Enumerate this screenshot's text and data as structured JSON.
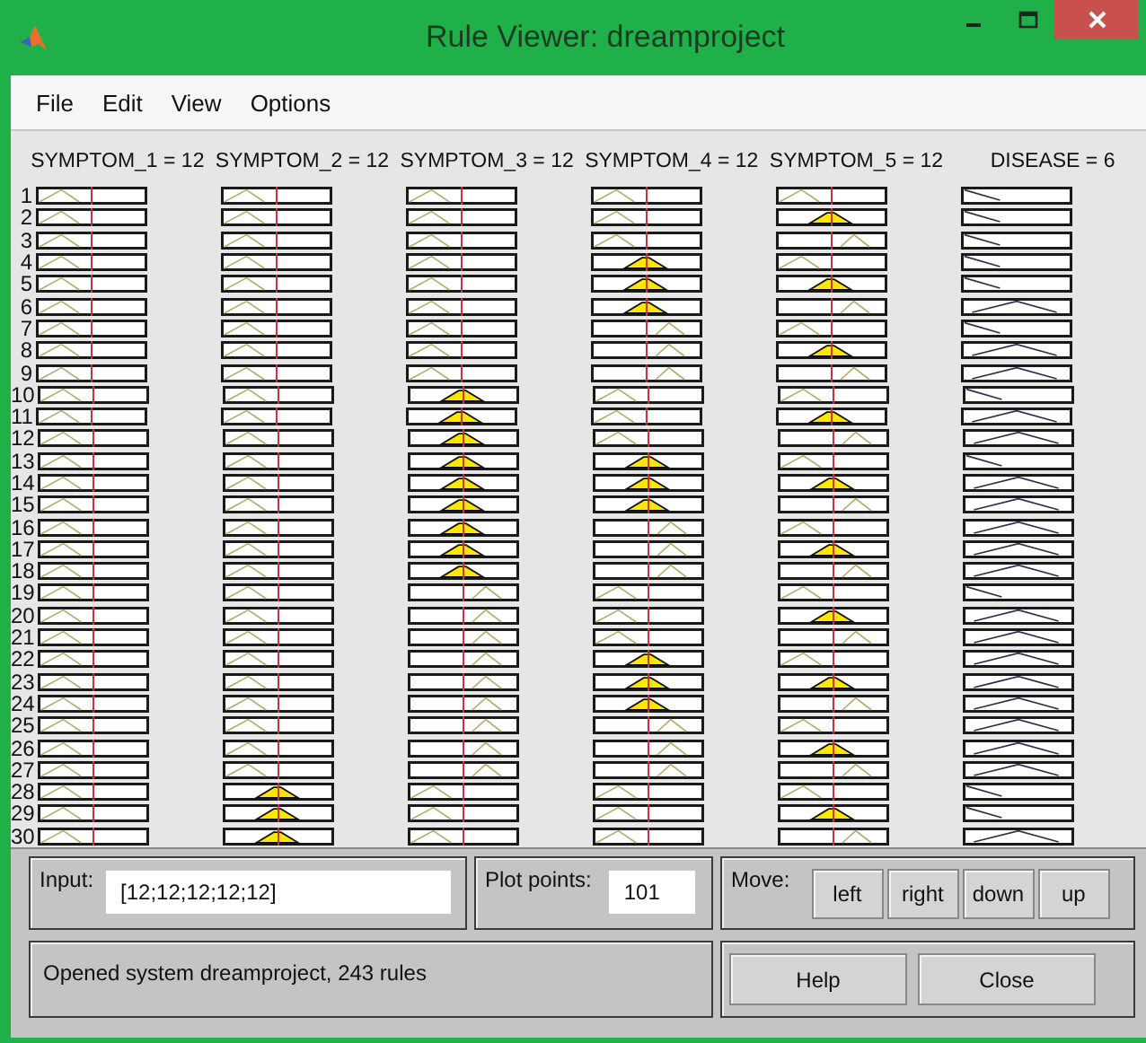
{
  "window": {
    "title": "Rule Viewer: dreamproject"
  },
  "menu": [
    "File",
    "Edit",
    "View",
    "Options"
  ],
  "variables": [
    {
      "label": "SYMPTOM_1 = 12",
      "kind": "input"
    },
    {
      "label": "SYMPTOM_2 = 12",
      "kind": "input"
    },
    {
      "label": "SYMPTOM_3 = 12",
      "kind": "input"
    },
    {
      "label": "SYMPTOM_4 = 12",
      "kind": "input"
    },
    {
      "label": "SYMPTOM_5 = 12",
      "kind": "input"
    },
    {
      "label": "DISEASE = 6",
      "kind": "output"
    }
  ],
  "rules": [
    {
      "number": "1",
      "inputs": [
        {
          "kind": "low",
          "fired": false
        },
        {
          "kind": "low",
          "fired": false
        },
        {
          "kind": "low",
          "fired": false
        },
        {
          "kind": "low",
          "fired": false
        },
        {
          "kind": "low",
          "fired": false
        }
      ],
      "output": {
        "kind": "low"
      }
    },
    {
      "number": "2",
      "inputs": [
        {
          "kind": "low",
          "fired": false
        },
        {
          "kind": "low",
          "fired": false
        },
        {
          "kind": "low",
          "fired": false
        },
        {
          "kind": "low",
          "fired": false
        },
        {
          "kind": "mid",
          "fired": true
        }
      ],
      "output": {
        "kind": "low"
      }
    },
    {
      "number": "3",
      "inputs": [
        {
          "kind": "low",
          "fired": false
        },
        {
          "kind": "low",
          "fired": false
        },
        {
          "kind": "low",
          "fired": false
        },
        {
          "kind": "low",
          "fired": false
        },
        {
          "kind": "high",
          "fired": false
        }
      ],
      "output": {
        "kind": "low"
      }
    },
    {
      "number": "4",
      "inputs": [
        {
          "kind": "low",
          "fired": false
        },
        {
          "kind": "low",
          "fired": false
        },
        {
          "kind": "low",
          "fired": false
        },
        {
          "kind": "mid",
          "fired": true
        },
        {
          "kind": "low",
          "fired": false
        }
      ],
      "output": {
        "kind": "low"
      }
    },
    {
      "number": "5",
      "inputs": [
        {
          "kind": "low",
          "fired": false
        },
        {
          "kind": "low",
          "fired": false
        },
        {
          "kind": "low",
          "fired": false
        },
        {
          "kind": "mid",
          "fired": true
        },
        {
          "kind": "mid",
          "fired": true
        }
      ],
      "output": {
        "kind": "low"
      }
    },
    {
      "number": "6",
      "inputs": [
        {
          "kind": "low",
          "fired": false
        },
        {
          "kind": "low",
          "fired": false
        },
        {
          "kind": "low",
          "fired": false
        },
        {
          "kind": "mid",
          "fired": true
        },
        {
          "kind": "high",
          "fired": false
        }
      ],
      "output": {
        "kind": "mid"
      }
    },
    {
      "number": "7",
      "inputs": [
        {
          "kind": "low",
          "fired": false
        },
        {
          "kind": "low",
          "fired": false
        },
        {
          "kind": "low",
          "fired": false
        },
        {
          "kind": "high",
          "fired": false
        },
        {
          "kind": "low",
          "fired": false
        }
      ],
      "output": {
        "kind": "low"
      }
    },
    {
      "number": "8",
      "inputs": [
        {
          "kind": "low",
          "fired": false
        },
        {
          "kind": "low",
          "fired": false
        },
        {
          "kind": "low",
          "fired": false
        },
        {
          "kind": "high",
          "fired": false
        },
        {
          "kind": "mid",
          "fired": true
        }
      ],
      "output": {
        "kind": "mid"
      }
    },
    {
      "number": "9",
      "inputs": [
        {
          "kind": "low",
          "fired": false
        },
        {
          "kind": "low",
          "fired": false
        },
        {
          "kind": "low",
          "fired": false
        },
        {
          "kind": "high",
          "fired": false
        },
        {
          "kind": "high",
          "fired": false
        }
      ],
      "output": {
        "kind": "mid"
      }
    },
    {
      "number": "10",
      "inputs": [
        {
          "kind": "low",
          "fired": false
        },
        {
          "kind": "low",
          "fired": false
        },
        {
          "kind": "mid",
          "fired": true
        },
        {
          "kind": "low",
          "fired": false
        },
        {
          "kind": "low",
          "fired": false
        }
      ],
      "output": {
        "kind": "low"
      }
    },
    {
      "number": "11",
      "inputs": [
        {
          "kind": "low",
          "fired": false
        },
        {
          "kind": "low",
          "fired": false
        },
        {
          "kind": "mid",
          "fired": true
        },
        {
          "kind": "low",
          "fired": false
        },
        {
          "kind": "mid",
          "fired": true
        }
      ],
      "output": {
        "kind": "mid"
      }
    },
    {
      "number": "12",
      "inputs": [
        {
          "kind": "low",
          "fired": false
        },
        {
          "kind": "low",
          "fired": false
        },
        {
          "kind": "mid",
          "fired": true
        },
        {
          "kind": "low",
          "fired": false
        },
        {
          "kind": "high",
          "fired": false
        }
      ],
      "output": {
        "kind": "mid"
      }
    },
    {
      "number": "13",
      "inputs": [
        {
          "kind": "low",
          "fired": false
        },
        {
          "kind": "low",
          "fired": false
        },
        {
          "kind": "mid",
          "fired": true
        },
        {
          "kind": "mid",
          "fired": true
        },
        {
          "kind": "low",
          "fired": false
        }
      ],
      "output": {
        "kind": "low"
      }
    },
    {
      "number": "14",
      "inputs": [
        {
          "kind": "low",
          "fired": false
        },
        {
          "kind": "low",
          "fired": false
        },
        {
          "kind": "mid",
          "fired": true
        },
        {
          "kind": "mid",
          "fired": true
        },
        {
          "kind": "mid",
          "fired": true
        }
      ],
      "output": {
        "kind": "mid"
      }
    },
    {
      "number": "15",
      "inputs": [
        {
          "kind": "low",
          "fired": false
        },
        {
          "kind": "low",
          "fired": false
        },
        {
          "kind": "mid",
          "fired": true
        },
        {
          "kind": "mid",
          "fired": true
        },
        {
          "kind": "high",
          "fired": false
        }
      ],
      "output": {
        "kind": "mid"
      }
    },
    {
      "number": "16",
      "inputs": [
        {
          "kind": "low",
          "fired": false
        },
        {
          "kind": "low",
          "fired": false
        },
        {
          "kind": "mid",
          "fired": true
        },
        {
          "kind": "high",
          "fired": false
        },
        {
          "kind": "low",
          "fired": false
        }
      ],
      "output": {
        "kind": "mid"
      }
    },
    {
      "number": "17",
      "inputs": [
        {
          "kind": "low",
          "fired": false
        },
        {
          "kind": "low",
          "fired": false
        },
        {
          "kind": "mid",
          "fired": true
        },
        {
          "kind": "high",
          "fired": false
        },
        {
          "kind": "mid",
          "fired": true
        }
      ],
      "output": {
        "kind": "mid"
      }
    },
    {
      "number": "18",
      "inputs": [
        {
          "kind": "low",
          "fired": false
        },
        {
          "kind": "low",
          "fired": false
        },
        {
          "kind": "mid",
          "fired": true
        },
        {
          "kind": "high",
          "fired": false
        },
        {
          "kind": "high",
          "fired": false
        }
      ],
      "output": {
        "kind": "mid"
      }
    },
    {
      "number": "19",
      "inputs": [
        {
          "kind": "low",
          "fired": false
        },
        {
          "kind": "low",
          "fired": false
        },
        {
          "kind": "high",
          "fired": false
        },
        {
          "kind": "low",
          "fired": false
        },
        {
          "kind": "low",
          "fired": false
        }
      ],
      "output": {
        "kind": "low"
      }
    },
    {
      "number": "20",
      "inputs": [
        {
          "kind": "low",
          "fired": false
        },
        {
          "kind": "low",
          "fired": false
        },
        {
          "kind": "high",
          "fired": false
        },
        {
          "kind": "low",
          "fired": false
        },
        {
          "kind": "mid",
          "fired": true
        }
      ],
      "output": {
        "kind": "mid"
      }
    },
    {
      "number": "21",
      "inputs": [
        {
          "kind": "low",
          "fired": false
        },
        {
          "kind": "low",
          "fired": false
        },
        {
          "kind": "high",
          "fired": false
        },
        {
          "kind": "low",
          "fired": false
        },
        {
          "kind": "high",
          "fired": false
        }
      ],
      "output": {
        "kind": "mid"
      }
    },
    {
      "number": "22",
      "inputs": [
        {
          "kind": "low",
          "fired": false
        },
        {
          "kind": "low",
          "fired": false
        },
        {
          "kind": "high",
          "fired": false
        },
        {
          "kind": "mid",
          "fired": true
        },
        {
          "kind": "low",
          "fired": false
        }
      ],
      "output": {
        "kind": "mid"
      }
    },
    {
      "number": "23",
      "inputs": [
        {
          "kind": "low",
          "fired": false
        },
        {
          "kind": "low",
          "fired": false
        },
        {
          "kind": "high",
          "fired": false
        },
        {
          "kind": "mid",
          "fired": true
        },
        {
          "kind": "mid",
          "fired": true
        }
      ],
      "output": {
        "kind": "mid"
      }
    },
    {
      "number": "24",
      "inputs": [
        {
          "kind": "low",
          "fired": false
        },
        {
          "kind": "low",
          "fired": false
        },
        {
          "kind": "high",
          "fired": false
        },
        {
          "kind": "mid",
          "fired": true
        },
        {
          "kind": "high",
          "fired": false
        }
      ],
      "output": {
        "kind": "mid"
      }
    },
    {
      "number": "25",
      "inputs": [
        {
          "kind": "low",
          "fired": false
        },
        {
          "kind": "low",
          "fired": false
        },
        {
          "kind": "high",
          "fired": false
        },
        {
          "kind": "high",
          "fired": false
        },
        {
          "kind": "low",
          "fired": false
        }
      ],
      "output": {
        "kind": "mid"
      }
    },
    {
      "number": "26",
      "inputs": [
        {
          "kind": "low",
          "fired": false
        },
        {
          "kind": "low",
          "fired": false
        },
        {
          "kind": "high",
          "fired": false
        },
        {
          "kind": "high",
          "fired": false
        },
        {
          "kind": "mid",
          "fired": true
        }
      ],
      "output": {
        "kind": "mid"
      }
    },
    {
      "number": "27",
      "inputs": [
        {
          "kind": "low",
          "fired": false
        },
        {
          "kind": "low",
          "fired": false
        },
        {
          "kind": "high",
          "fired": false
        },
        {
          "kind": "high",
          "fired": false
        },
        {
          "kind": "high",
          "fired": false
        }
      ],
      "output": {
        "kind": "mid"
      }
    },
    {
      "number": "28",
      "inputs": [
        {
          "kind": "low",
          "fired": false
        },
        {
          "kind": "mid",
          "fired": true
        },
        {
          "kind": "low",
          "fired": false
        },
        {
          "kind": "low",
          "fired": false
        },
        {
          "kind": "low",
          "fired": false
        }
      ],
      "output": {
        "kind": "low"
      }
    },
    {
      "number": "29",
      "inputs": [
        {
          "kind": "low",
          "fired": false
        },
        {
          "kind": "mid",
          "fired": true
        },
        {
          "kind": "low",
          "fired": false
        },
        {
          "kind": "low",
          "fired": false
        },
        {
          "kind": "mid",
          "fired": true
        }
      ],
      "output": {
        "kind": "low"
      }
    },
    {
      "number": "30",
      "inputs": [
        {
          "kind": "low",
          "fired": false
        },
        {
          "kind": "mid",
          "fired": true
        },
        {
          "kind": "low",
          "fired": false
        },
        {
          "kind": "low",
          "fired": false
        },
        {
          "kind": "high",
          "fired": false
        }
      ],
      "output": {
        "kind": "mid"
      }
    }
  ],
  "input_field": {
    "label": "Input:",
    "value": "[12;12;12;12;12]"
  },
  "plot_points": {
    "label": "Plot points:",
    "value": "101"
  },
  "move": {
    "label": "Move:",
    "buttons": [
      "left",
      "right",
      "down",
      "up"
    ]
  },
  "status": "Opened system dreamproject, 243 rules",
  "buttons": [
    "Help",
    "Close"
  ]
}
